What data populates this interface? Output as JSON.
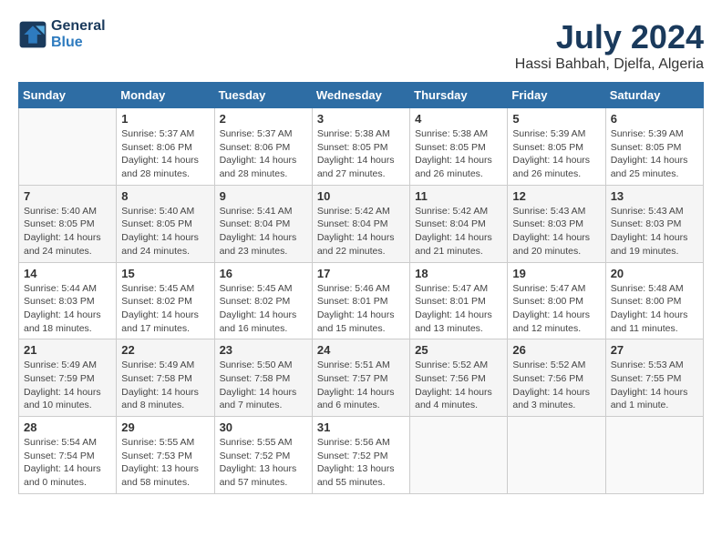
{
  "header": {
    "logo_line1": "General",
    "logo_line2": "Blue",
    "month": "July 2024",
    "location": "Hassi Bahbah, Djelfa, Algeria"
  },
  "weekdays": [
    "Sunday",
    "Monday",
    "Tuesday",
    "Wednesday",
    "Thursday",
    "Friday",
    "Saturday"
  ],
  "weeks": [
    [
      {
        "day": "",
        "info": ""
      },
      {
        "day": "1",
        "info": "Sunrise: 5:37 AM\nSunset: 8:06 PM\nDaylight: 14 hours\nand 28 minutes."
      },
      {
        "day": "2",
        "info": "Sunrise: 5:37 AM\nSunset: 8:06 PM\nDaylight: 14 hours\nand 28 minutes."
      },
      {
        "day": "3",
        "info": "Sunrise: 5:38 AM\nSunset: 8:05 PM\nDaylight: 14 hours\nand 27 minutes."
      },
      {
        "day": "4",
        "info": "Sunrise: 5:38 AM\nSunset: 8:05 PM\nDaylight: 14 hours\nand 26 minutes."
      },
      {
        "day": "5",
        "info": "Sunrise: 5:39 AM\nSunset: 8:05 PM\nDaylight: 14 hours\nand 26 minutes."
      },
      {
        "day": "6",
        "info": "Sunrise: 5:39 AM\nSunset: 8:05 PM\nDaylight: 14 hours\nand 25 minutes."
      }
    ],
    [
      {
        "day": "7",
        "info": "Sunrise: 5:40 AM\nSunset: 8:05 PM\nDaylight: 14 hours\nand 24 minutes."
      },
      {
        "day": "8",
        "info": "Sunrise: 5:40 AM\nSunset: 8:05 PM\nDaylight: 14 hours\nand 24 minutes."
      },
      {
        "day": "9",
        "info": "Sunrise: 5:41 AM\nSunset: 8:04 PM\nDaylight: 14 hours\nand 23 minutes."
      },
      {
        "day": "10",
        "info": "Sunrise: 5:42 AM\nSunset: 8:04 PM\nDaylight: 14 hours\nand 22 minutes."
      },
      {
        "day": "11",
        "info": "Sunrise: 5:42 AM\nSunset: 8:04 PM\nDaylight: 14 hours\nand 21 minutes."
      },
      {
        "day": "12",
        "info": "Sunrise: 5:43 AM\nSunset: 8:03 PM\nDaylight: 14 hours\nand 20 minutes."
      },
      {
        "day": "13",
        "info": "Sunrise: 5:43 AM\nSunset: 8:03 PM\nDaylight: 14 hours\nand 19 minutes."
      }
    ],
    [
      {
        "day": "14",
        "info": "Sunrise: 5:44 AM\nSunset: 8:03 PM\nDaylight: 14 hours\nand 18 minutes."
      },
      {
        "day": "15",
        "info": "Sunrise: 5:45 AM\nSunset: 8:02 PM\nDaylight: 14 hours\nand 17 minutes."
      },
      {
        "day": "16",
        "info": "Sunrise: 5:45 AM\nSunset: 8:02 PM\nDaylight: 14 hours\nand 16 minutes."
      },
      {
        "day": "17",
        "info": "Sunrise: 5:46 AM\nSunset: 8:01 PM\nDaylight: 14 hours\nand 15 minutes."
      },
      {
        "day": "18",
        "info": "Sunrise: 5:47 AM\nSunset: 8:01 PM\nDaylight: 14 hours\nand 13 minutes."
      },
      {
        "day": "19",
        "info": "Sunrise: 5:47 AM\nSunset: 8:00 PM\nDaylight: 14 hours\nand 12 minutes."
      },
      {
        "day": "20",
        "info": "Sunrise: 5:48 AM\nSunset: 8:00 PM\nDaylight: 14 hours\nand 11 minutes."
      }
    ],
    [
      {
        "day": "21",
        "info": "Sunrise: 5:49 AM\nSunset: 7:59 PM\nDaylight: 14 hours\nand 10 minutes."
      },
      {
        "day": "22",
        "info": "Sunrise: 5:49 AM\nSunset: 7:58 PM\nDaylight: 14 hours\nand 8 minutes."
      },
      {
        "day": "23",
        "info": "Sunrise: 5:50 AM\nSunset: 7:58 PM\nDaylight: 14 hours\nand 7 minutes."
      },
      {
        "day": "24",
        "info": "Sunrise: 5:51 AM\nSunset: 7:57 PM\nDaylight: 14 hours\nand 6 minutes."
      },
      {
        "day": "25",
        "info": "Sunrise: 5:52 AM\nSunset: 7:56 PM\nDaylight: 14 hours\nand 4 minutes."
      },
      {
        "day": "26",
        "info": "Sunrise: 5:52 AM\nSunset: 7:56 PM\nDaylight: 14 hours\nand 3 minutes."
      },
      {
        "day": "27",
        "info": "Sunrise: 5:53 AM\nSunset: 7:55 PM\nDaylight: 14 hours\nand 1 minute."
      }
    ],
    [
      {
        "day": "28",
        "info": "Sunrise: 5:54 AM\nSunset: 7:54 PM\nDaylight: 14 hours\nand 0 minutes."
      },
      {
        "day": "29",
        "info": "Sunrise: 5:55 AM\nSunset: 7:53 PM\nDaylight: 13 hours\nand 58 minutes."
      },
      {
        "day": "30",
        "info": "Sunrise: 5:55 AM\nSunset: 7:52 PM\nDaylight: 13 hours\nand 57 minutes."
      },
      {
        "day": "31",
        "info": "Sunrise: 5:56 AM\nSunset: 7:52 PM\nDaylight: 13 hours\nand 55 minutes."
      },
      {
        "day": "",
        "info": ""
      },
      {
        "day": "",
        "info": ""
      },
      {
        "day": "",
        "info": ""
      }
    ]
  ]
}
